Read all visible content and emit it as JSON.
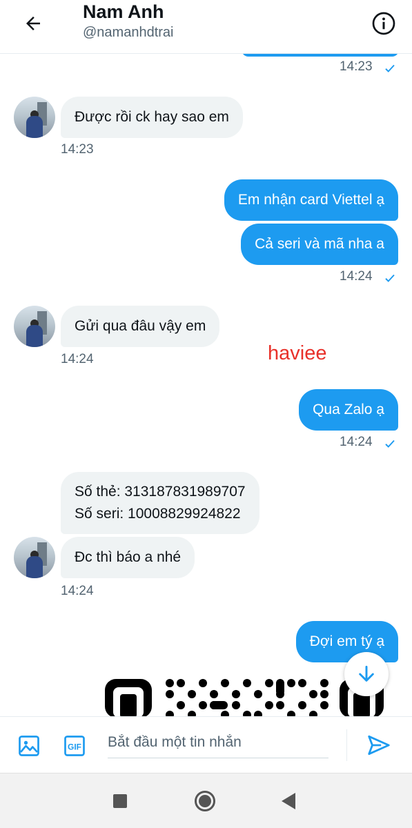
{
  "header": {
    "title": "Nam Anh",
    "handle": "@namanhdtrai",
    "back_icon": "arrow-left-icon",
    "info_icon": "info-icon"
  },
  "messages": [
    {
      "side": "out",
      "time": "14:23"
    },
    {
      "side": "in",
      "text": "Được rồi ck hay sao em",
      "time": "14:23"
    },
    {
      "side": "out",
      "text": "Em nhận card Viettel ạ"
    },
    {
      "side": "out",
      "text": "Cả seri và mã nha a",
      "time": "14:24"
    },
    {
      "side": "in",
      "text": "Gửi qua đâu vậy em",
      "time": "14:24"
    },
    {
      "side": "out",
      "text": "Qua Zalo ạ",
      "time": "14:24"
    },
    {
      "side": "in",
      "lines": [
        "Số thẻ: 313187831989707",
        "Số seri: 10008829924822"
      ]
    },
    {
      "side": "in",
      "text": "Đc thì báo a nhé",
      "time": "14:24"
    },
    {
      "side": "out",
      "text": "Đợi em tý ạ"
    }
  ],
  "watermark": "haviee",
  "composer": {
    "placeholder": "Bắt đầu một tin nhắn",
    "gif_label": "GIF",
    "media_icon": "image-icon",
    "send_icon": "send-icon"
  },
  "colors": {
    "accent": "#1d9bf0",
    "incoming_bubble": "#eff3f4",
    "watermark": "#e8312a"
  }
}
